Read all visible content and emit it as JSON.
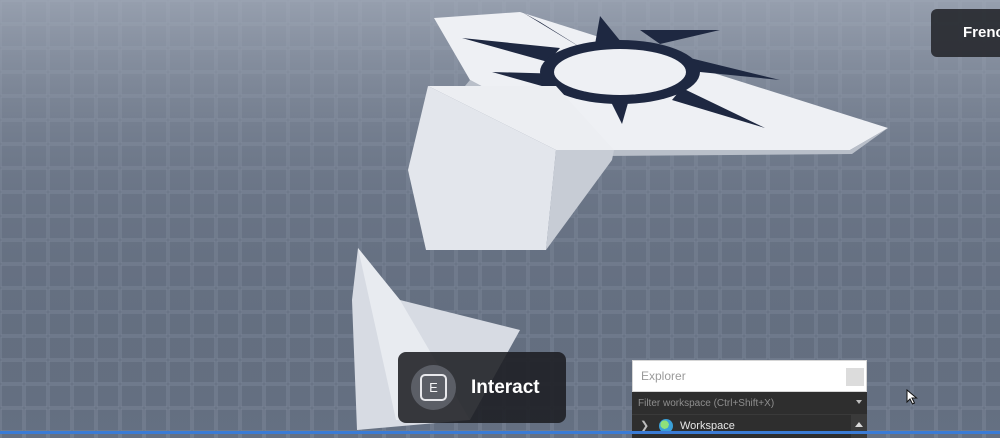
{
  "top_chip": {
    "text": "Frenc"
  },
  "interact_prompt": {
    "key": "E",
    "label": "Interact"
  },
  "explorer": {
    "title": "Explorer",
    "filter_placeholder": "Filter workspace (Ctrl+Shift+X)",
    "rows": [
      {
        "label": "Workspace",
        "icon": "globe-icon"
      }
    ]
  },
  "colors": {
    "baseplate": "#5c6473",
    "part": "#e9ecf1",
    "decal": "#1f2a40",
    "selection_accent": "#3a7bd5"
  }
}
